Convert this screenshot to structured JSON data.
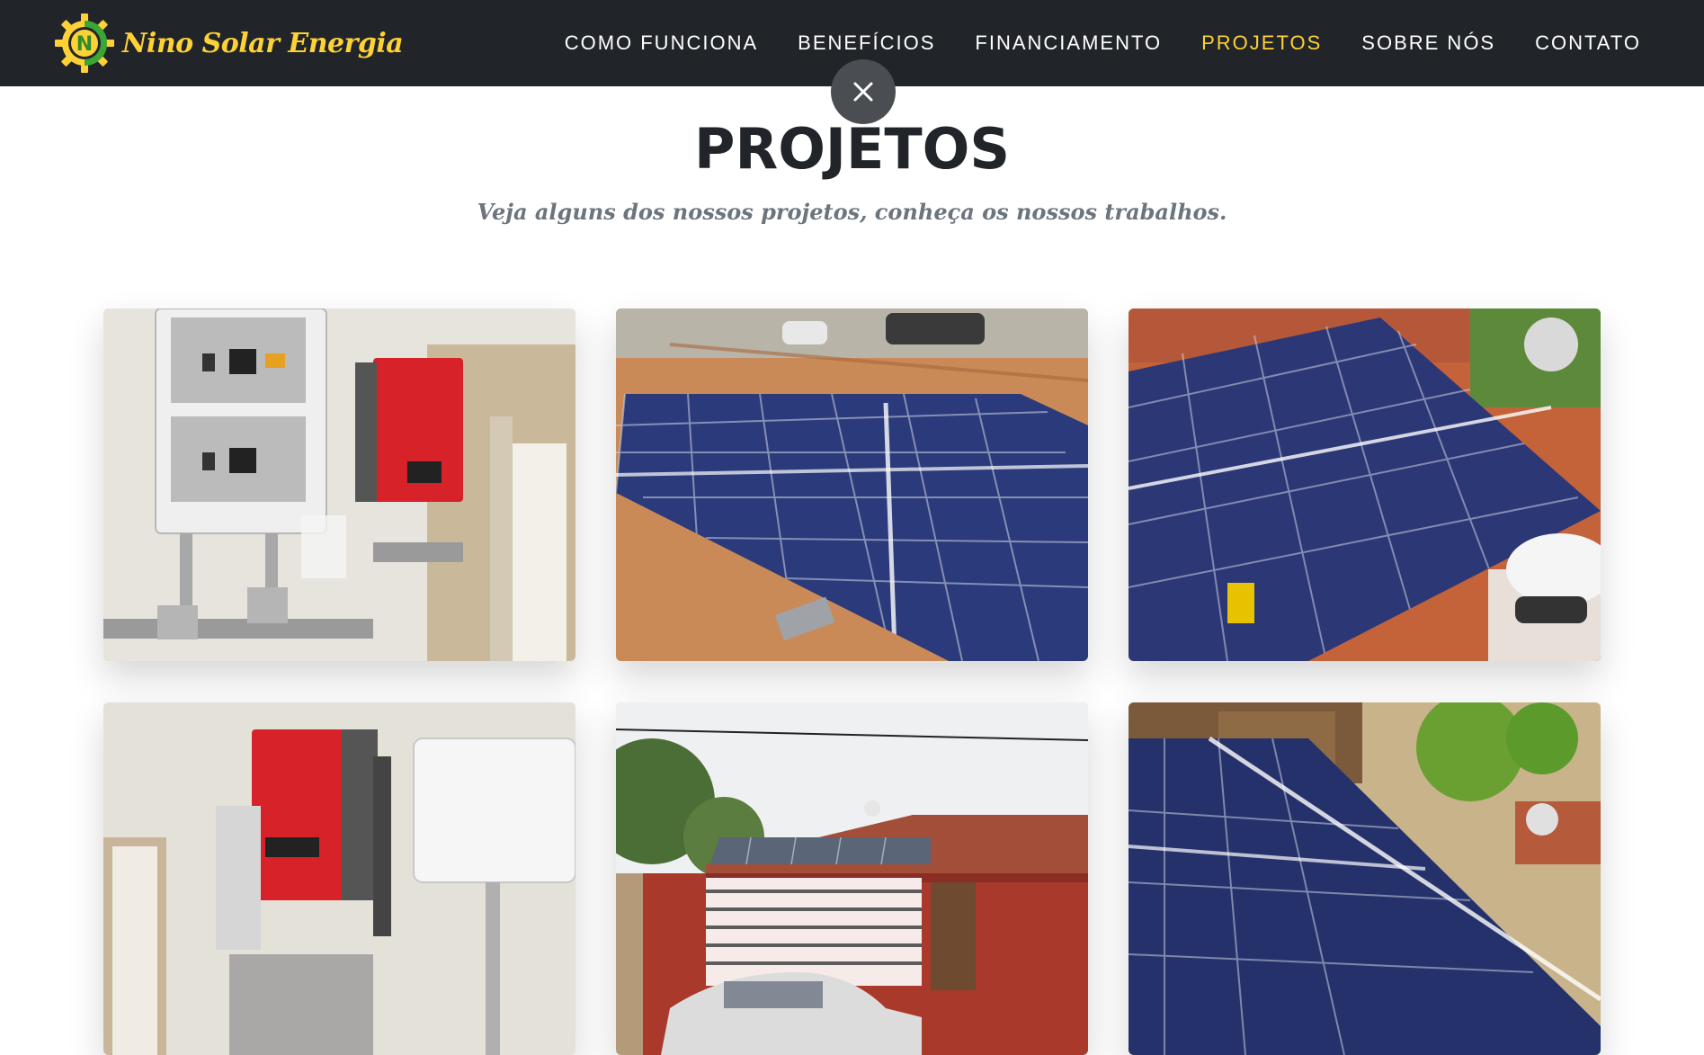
{
  "brand": {
    "name": "Nino Solar Energia",
    "logo_letter": "N"
  },
  "nav": {
    "items": [
      {
        "label": "COMO FUNCIONA",
        "active": false
      },
      {
        "label": "BENEFÍCIOS",
        "active": false
      },
      {
        "label": "FINANCIAMENTO",
        "active": false
      },
      {
        "label": "PROJETOS",
        "active": true
      },
      {
        "label": "SOBRE NÓS",
        "active": false
      },
      {
        "label": "CONTATO",
        "active": false
      }
    ]
  },
  "close_button": {
    "icon": "close-icon"
  },
  "section": {
    "heading": "PROJETOS",
    "subheading": "Veja alguns dos nossos projetos, conheça os nossos trabalhos."
  },
  "gallery": {
    "items": [
      {
        "photo": "inverter-wall-photo"
      },
      {
        "photo": "solar-panels-roof-photo"
      },
      {
        "photo": "solar-panels-installer-photo"
      },
      {
        "photo": "inverter-installation-photo"
      },
      {
        "photo": "house-with-solar-roof-photo"
      },
      {
        "photo": "solar-panels-tilted-photo"
      }
    ]
  },
  "colors": {
    "navbar_bg": "#212529",
    "accent": "#fed136",
    "logo_green": "#3aa635",
    "heading": "#212529",
    "subheading": "#6c757d",
    "close_bg": "#4a4d51",
    "panel_blue": "#2a3a7a",
    "roof_tile": "#c96f3e"
  }
}
